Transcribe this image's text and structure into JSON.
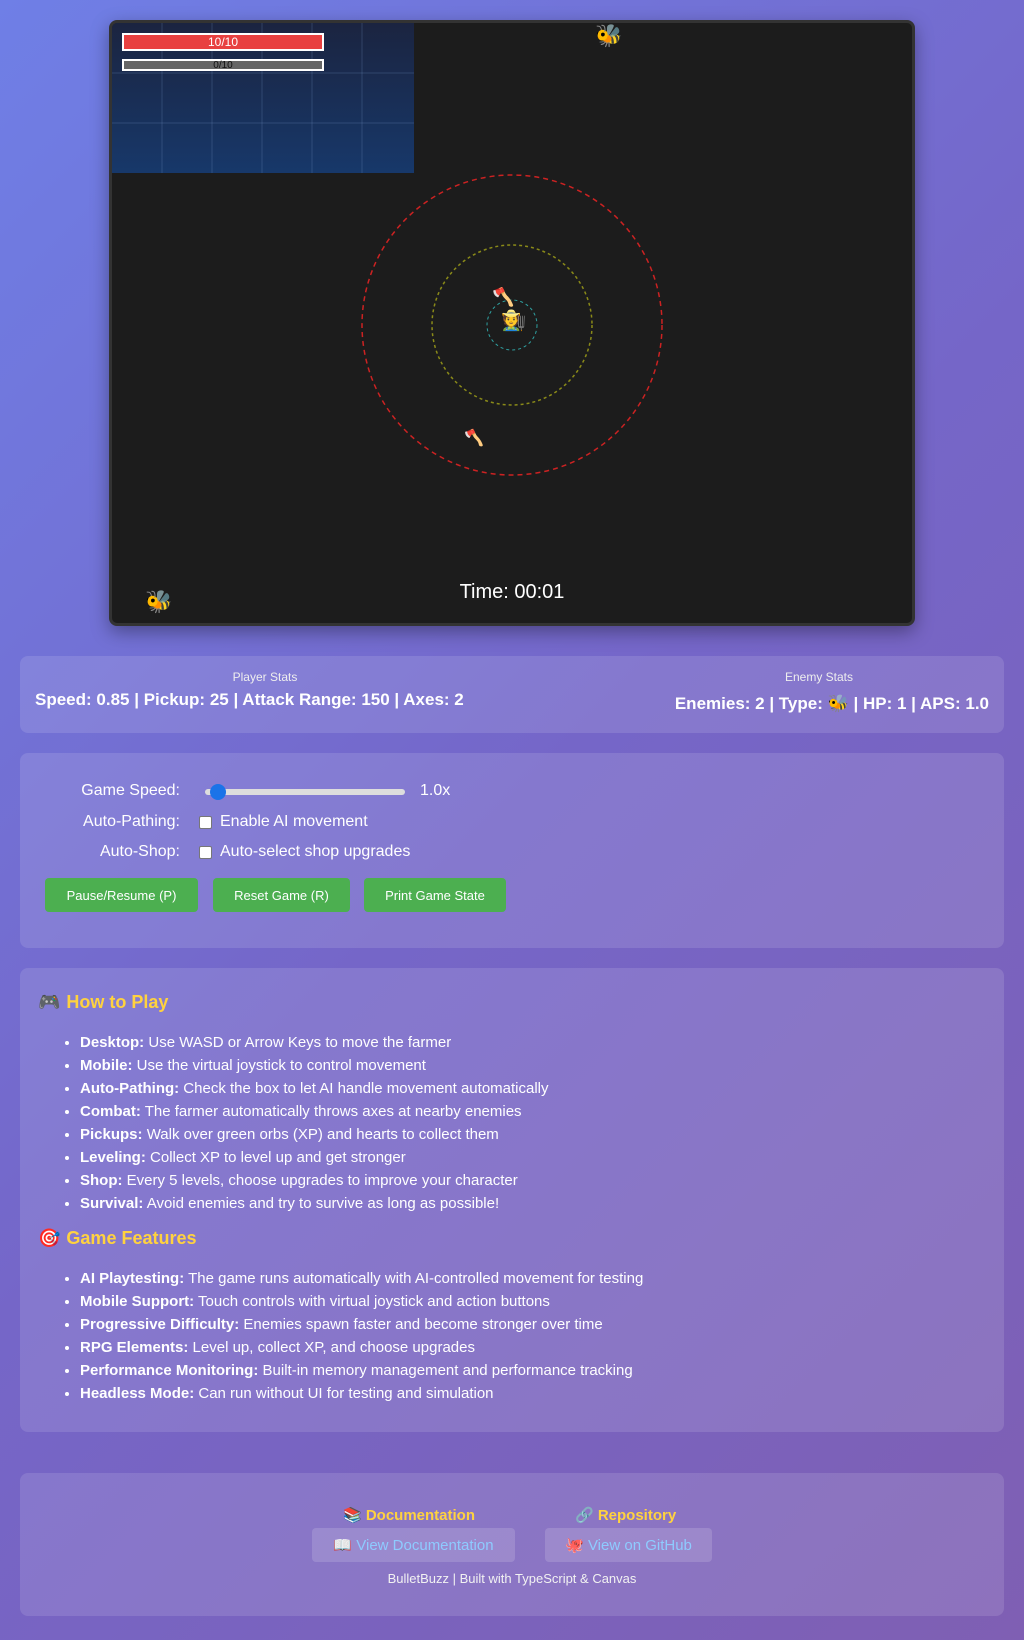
{
  "hud": {
    "hp_text": "10/10",
    "hp_fraction": 1.0,
    "xp_text": "0/10",
    "xp_fraction": 0.0,
    "timer": "Time: 00:01"
  },
  "sprites": {
    "player_icon": "🧑‍🌾",
    "enemy_icon": "🐝",
    "axe_icon": "🪓"
  },
  "colors": {
    "hp_bar": "#e84040",
    "attack_ring": "#cc2222",
    "pickup_ring": "#8a8a18",
    "player_ring": "#2fa0a0",
    "button": "#4caf50",
    "heading": "#ffd23f",
    "link": "#8ecbff"
  },
  "stats": {
    "player_caption": "Player Stats",
    "player_values": "Speed: 0.85 | Pickup: 25 | Attack Range: 150 | Axes: 2",
    "enemy_caption": "Enemy Stats",
    "enemy_prefix": "Enemies: 2 | Type: ",
    "enemy_suffix": " | HP: 1 | APS: 1.0"
  },
  "controls": {
    "speed_label": "Game Speed:",
    "speed_value": "1.0x",
    "speed_fraction": 0.0,
    "autopath_label": "Auto-Pathing:",
    "autopath_text": "Enable AI movement",
    "autoshop_label": "Auto-Shop:",
    "autoshop_text": "Auto-select shop upgrades",
    "pause_button": "Pause/Resume (P)",
    "reset_button": "Reset Game (R)",
    "print_button": "Print Game State"
  },
  "howto": {
    "icon": "🎮",
    "title": "How to Play",
    "items": [
      {
        "label": "Desktop:",
        "text": " Use WASD or Arrow Keys to move the farmer"
      },
      {
        "label": "Mobile:",
        "text": " Use the virtual joystick to control movement"
      },
      {
        "label": "Auto-Pathing:",
        "text": " Check the box to let AI handle movement automatically"
      },
      {
        "label": "Combat:",
        "text": " The farmer automatically throws axes at nearby enemies"
      },
      {
        "label": "Pickups:",
        "text": " Walk over green orbs (XP) and hearts to collect them"
      },
      {
        "label": "Leveling:",
        "text": " Collect XP to level up and get stronger"
      },
      {
        "label": "Shop:",
        "text": " Every 5 levels, choose upgrades to improve your character"
      },
      {
        "label": "Survival:",
        "text": " Avoid enemies and try to survive as long as possible!"
      }
    ]
  },
  "features": {
    "icon": "🎯",
    "title": "Game Features",
    "items": [
      {
        "label": "AI Playtesting:",
        "text": " The game runs automatically with AI-controlled movement for testing"
      },
      {
        "label": "Mobile Support:",
        "text": " Touch controls with virtual joystick and action buttons"
      },
      {
        "label": "Progressive Difficulty:",
        "text": " Enemies spawn faster and become stronger over time"
      },
      {
        "label": "RPG Elements:",
        "text": " Level up, collect XP, and choose upgrades"
      },
      {
        "label": "Performance Monitoring:",
        "text": " Built-in memory management and performance tracking"
      },
      {
        "label": "Headless Mode:",
        "text": " Can run without UI for testing and simulation"
      }
    ]
  },
  "footer": {
    "docs_heading": "📚 Documentation",
    "repo_heading": "🔗 Repository",
    "docs_link": "📖 View Documentation",
    "repo_link": "🐙 View on GitHub",
    "credit": "BulletBuzz | Built with TypeScript & Canvas"
  }
}
